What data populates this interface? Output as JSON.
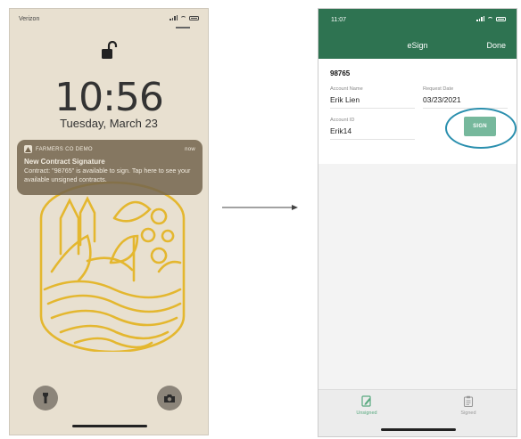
{
  "lock_screen": {
    "carrier": "Verizon",
    "time": "10:56",
    "date": "Tuesday, March 23",
    "notification": {
      "app_name": "FARMERS CO DEMO",
      "time": "now",
      "title": "New Contract Signature",
      "body": "Contract: \"98765\" is available to sign. Tap here to see your available unsigned contracts."
    }
  },
  "esign_app": {
    "status_time": "11:07",
    "title": "eSign",
    "done_label": "Done",
    "contract": {
      "id": "98765",
      "account_name_label": "Account Name",
      "account_name": "Erik Lien",
      "request_date_label": "Request Date",
      "request_date": "03/23/2021",
      "account_id_label": "Account ID",
      "account_id": "Erik14",
      "sign_label": "SIGN"
    },
    "tabs": [
      {
        "label": "Unsigned",
        "icon": "edit-document-icon",
        "active": true
      },
      {
        "label": "Signed",
        "icon": "clipboard-icon",
        "active": false
      }
    ]
  },
  "colors": {
    "header_green": "#2e7351",
    "sign_button": "#76b89c",
    "highlight_circle": "#2a8fae",
    "art_yellow": "#e4b72f"
  }
}
